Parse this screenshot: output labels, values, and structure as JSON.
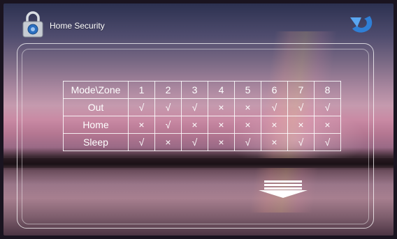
{
  "header": {
    "title": "Home Security",
    "lock_icon": "lock-icon",
    "back_icon": "back-arrow-icon"
  },
  "table": {
    "corner_label": "Mode\\Zone",
    "zones": [
      "1",
      "2",
      "3",
      "4",
      "5",
      "6",
      "7",
      "8"
    ],
    "rows": [
      {
        "mode": "Out",
        "cells": [
          "√",
          "√",
          "√",
          "×",
          "×",
          "√",
          "√",
          "√"
        ]
      },
      {
        "mode": "Home",
        "cells": [
          "×",
          "√",
          "×",
          "×",
          "×",
          "×",
          "×",
          "×"
        ]
      },
      {
        "mode": "Sleep",
        "cells": [
          "√",
          "×",
          "√",
          "×",
          "√",
          "×",
          "√",
          "√"
        ]
      }
    ]
  },
  "footer": {
    "scroll_icon": "scroll-down-arrow-icon"
  },
  "colors": {
    "text": "#ffffff",
    "accent_blue": "#2f7fd6"
  }
}
